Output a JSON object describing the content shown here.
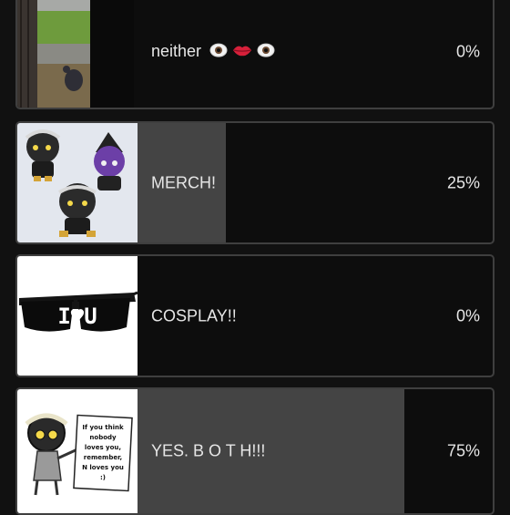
{
  "poll": {
    "options": [
      {
        "label": "neither",
        "percent": 0,
        "percent_label": "0%",
        "emoji": [
          "eye-icon",
          "lips-icon",
          "eye-icon"
        ]
      },
      {
        "label": "MERCH!",
        "percent": 25,
        "percent_label": "25%"
      },
      {
        "label": "COSPLAY!!",
        "percent": 0,
        "percent_label": "0%"
      },
      {
        "label": "YES. B O T H!!!",
        "percent": 75,
        "percent_label": "75%"
      }
    ]
  },
  "sign_text": [
    "If you think",
    "nobody",
    "loves you,",
    "remember,",
    "N loves you",
    ":)"
  ],
  "glasses_text": "I♥U",
  "colors": {
    "bar_fill": "#444444",
    "card_bg": "#0d0d0d",
    "border": "#3f3f3f",
    "text": "#e6e6e6"
  }
}
